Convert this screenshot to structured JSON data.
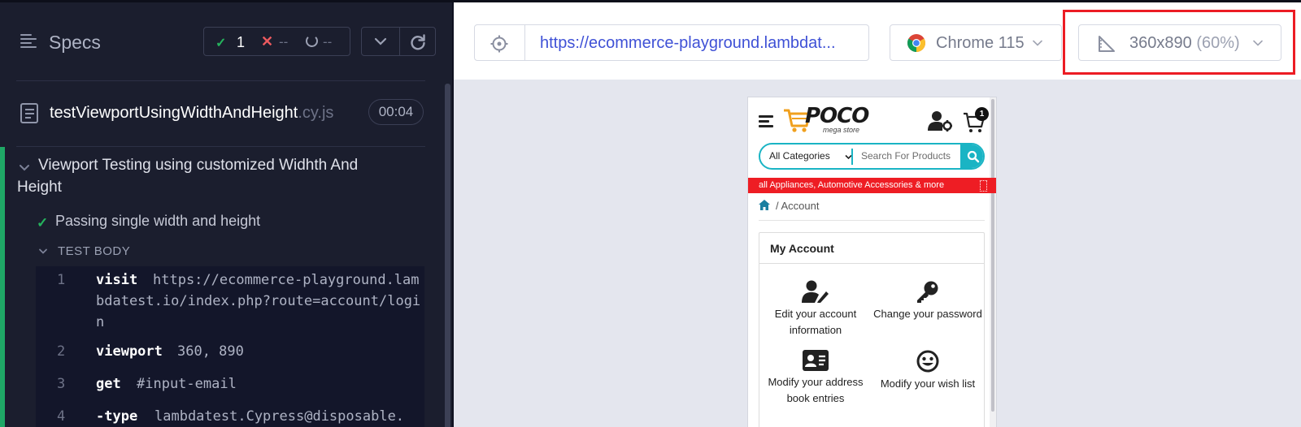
{
  "specs": {
    "title": "Specs",
    "passed": "1",
    "failed": "--",
    "pending": "--",
    "file": {
      "name": "testViewportUsingWidthAndHeight",
      "ext": ".cy.js",
      "duration": "00:04"
    },
    "suite_title": "Viewport Testing using customized Widhth And Height",
    "test_title": "Passing single width and height",
    "body_label": "TEST BODY",
    "commands": [
      {
        "num": "1",
        "name": "visit",
        "arg": "https://ecommerce-playground.lambdatest.io/index.php?route=account/login"
      },
      {
        "num": "2",
        "name": "viewport",
        "arg": "360, 890"
      },
      {
        "num": "3",
        "name": "get",
        "arg": "#input-email"
      },
      {
        "num": "4",
        "name": "-type",
        "arg": "lambdatest.Cypress@disposable."
      }
    ]
  },
  "aut": {
    "url": "https://ecommerce-playground.lambdat...",
    "browser": "Chrome 115",
    "viewport_size": "360x890",
    "viewport_scale": "(60%)",
    "highlight_color": "#ec1c24"
  },
  "site": {
    "logo": "POCO",
    "logo_sub": "mega store",
    "cart_count": "1",
    "category_label": "All Categories",
    "search_placeholder": "Search For Products",
    "promo": "all Appliances, Automotive Accessories & more",
    "breadcrumb": "/ Account",
    "card_title": "My Account",
    "tiles": [
      {
        "icon": "user-edit-icon",
        "label": "Edit your account information"
      },
      {
        "icon": "key-icon",
        "label": "Change your password"
      },
      {
        "icon": "address-card-icon",
        "label": "Modify your address book entries"
      },
      {
        "icon": "smile-icon",
        "label": "Modify your wish list"
      }
    ],
    "accent": "#1ab4c4",
    "promo_color": "#ee1d24"
  }
}
